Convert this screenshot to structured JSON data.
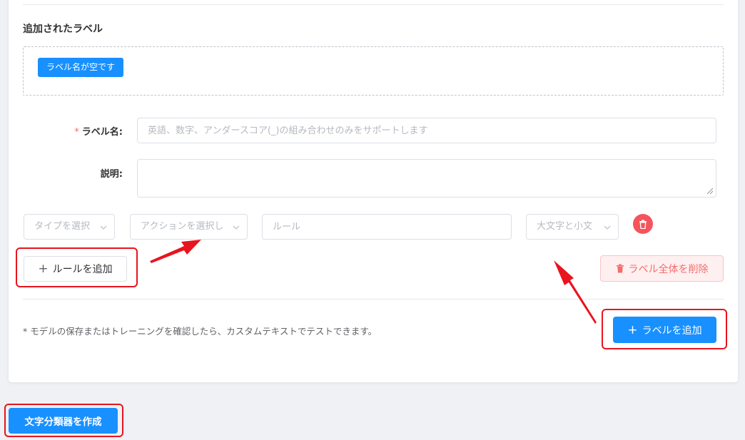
{
  "section": {
    "title": "追加されたラベル",
    "empty_tag": "ラベル名が空です"
  },
  "form": {
    "name_label": "ラベル名:",
    "name_required_mark": "*",
    "name_placeholder": "英語、数字、アンダースコア(_)の組み合わせのみをサポートします",
    "desc_label": "説明:"
  },
  "rule": {
    "type_select": "タイプを選択",
    "action_select": "アクションを選択し",
    "rule_placeholder": "ルール",
    "case_select": "大文字と小文",
    "add_rule": "ルールを追加",
    "delete_all_labels": "ラベル全体を削除"
  },
  "footer": {
    "note": "* モデルの保存またはトレーニングを確認したら、カスタムテキストでテストできます。",
    "add_label": "ラベルを追加"
  },
  "create_button": "文字分類器を作成",
  "colors": {
    "primary": "#1890ff",
    "danger": "#f56c6c",
    "highlight": "#e8141e"
  }
}
